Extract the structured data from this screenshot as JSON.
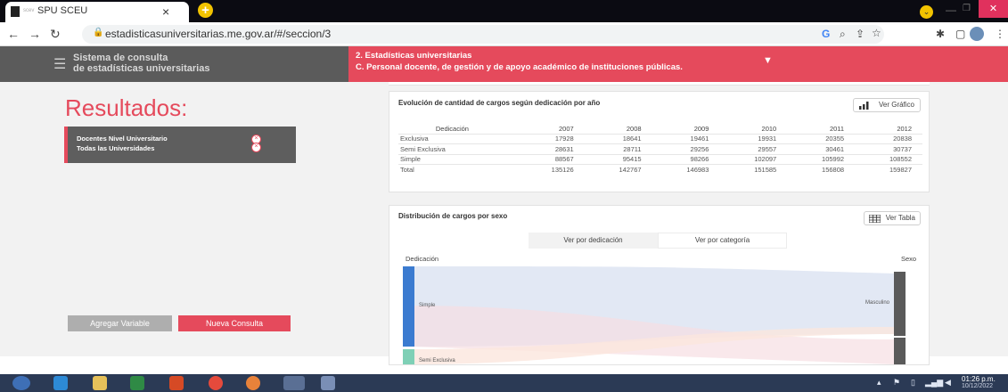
{
  "browser": {
    "tab_small_label": "scev",
    "tab_title": "SPU SCEU",
    "tab_close": "×",
    "new_tab": "+",
    "url": "estadisticasuniversitarias.me.gov.ar/#/seccion/3"
  },
  "header": {
    "system_title_line1": "Sistema de consulta",
    "system_title_line2": "de estadísticas universitarias",
    "breadcrumb_line1": "2. Estadísticas universitarias",
    "breadcrumb_line2": "C. Personal docente, de gestión y de apoyo académico de instituciones públicas."
  },
  "sidebar": {
    "results_title": "Resultados:",
    "selection_line1": "Docentes Nivel Universitario",
    "selection_line2": "Todas las Universidades",
    "add_variable_label": "Agregar Variable",
    "new_query_label": "Nueva Consulta"
  },
  "table_card": {
    "title": "Evolución de cantidad de cargos según dedicación por año",
    "button_label": "Ver Gráfico",
    "headers": [
      "Dedicación",
      "2007",
      "2008",
      "2009",
      "2010",
      "2011",
      "2012"
    ],
    "rows": [
      [
        "Exclusiva",
        "17928",
        "18641",
        "19461",
        "19931",
        "20355",
        "20838"
      ],
      [
        "Semi Exclusiva",
        "28631",
        "28711",
        "29256",
        "29557",
        "30461",
        "30737"
      ],
      [
        "Simple",
        "88567",
        "95415",
        "98266",
        "102097",
        "105992",
        "108552"
      ],
      [
        "Total",
        "135126",
        "142767",
        "146983",
        "151585",
        "156808",
        "159827"
      ]
    ]
  },
  "sankey_card": {
    "title": "Distribución de cargos por sexo",
    "button_label": "Ver Tabla",
    "toggle_dedicacion": "Ver por dedicación",
    "toggle_categoria": "Ver por categoría",
    "left_axis_label": "Dedicación",
    "right_axis_label": "Sexo",
    "node_simple": "Simple",
    "node_semi": "Semi Exclusiva",
    "node_masculino": "Masculino",
    "colors": {
      "simple": "#3b7bd0",
      "semi": "#7fd0b6",
      "masculino": "#5a5a5a"
    }
  },
  "taskbar": {
    "time": "01:26 p.m.",
    "date": "10/12/2022"
  },
  "colors": {
    "accent": "#e54a5c",
    "header_gray": "#5b5b5b"
  }
}
